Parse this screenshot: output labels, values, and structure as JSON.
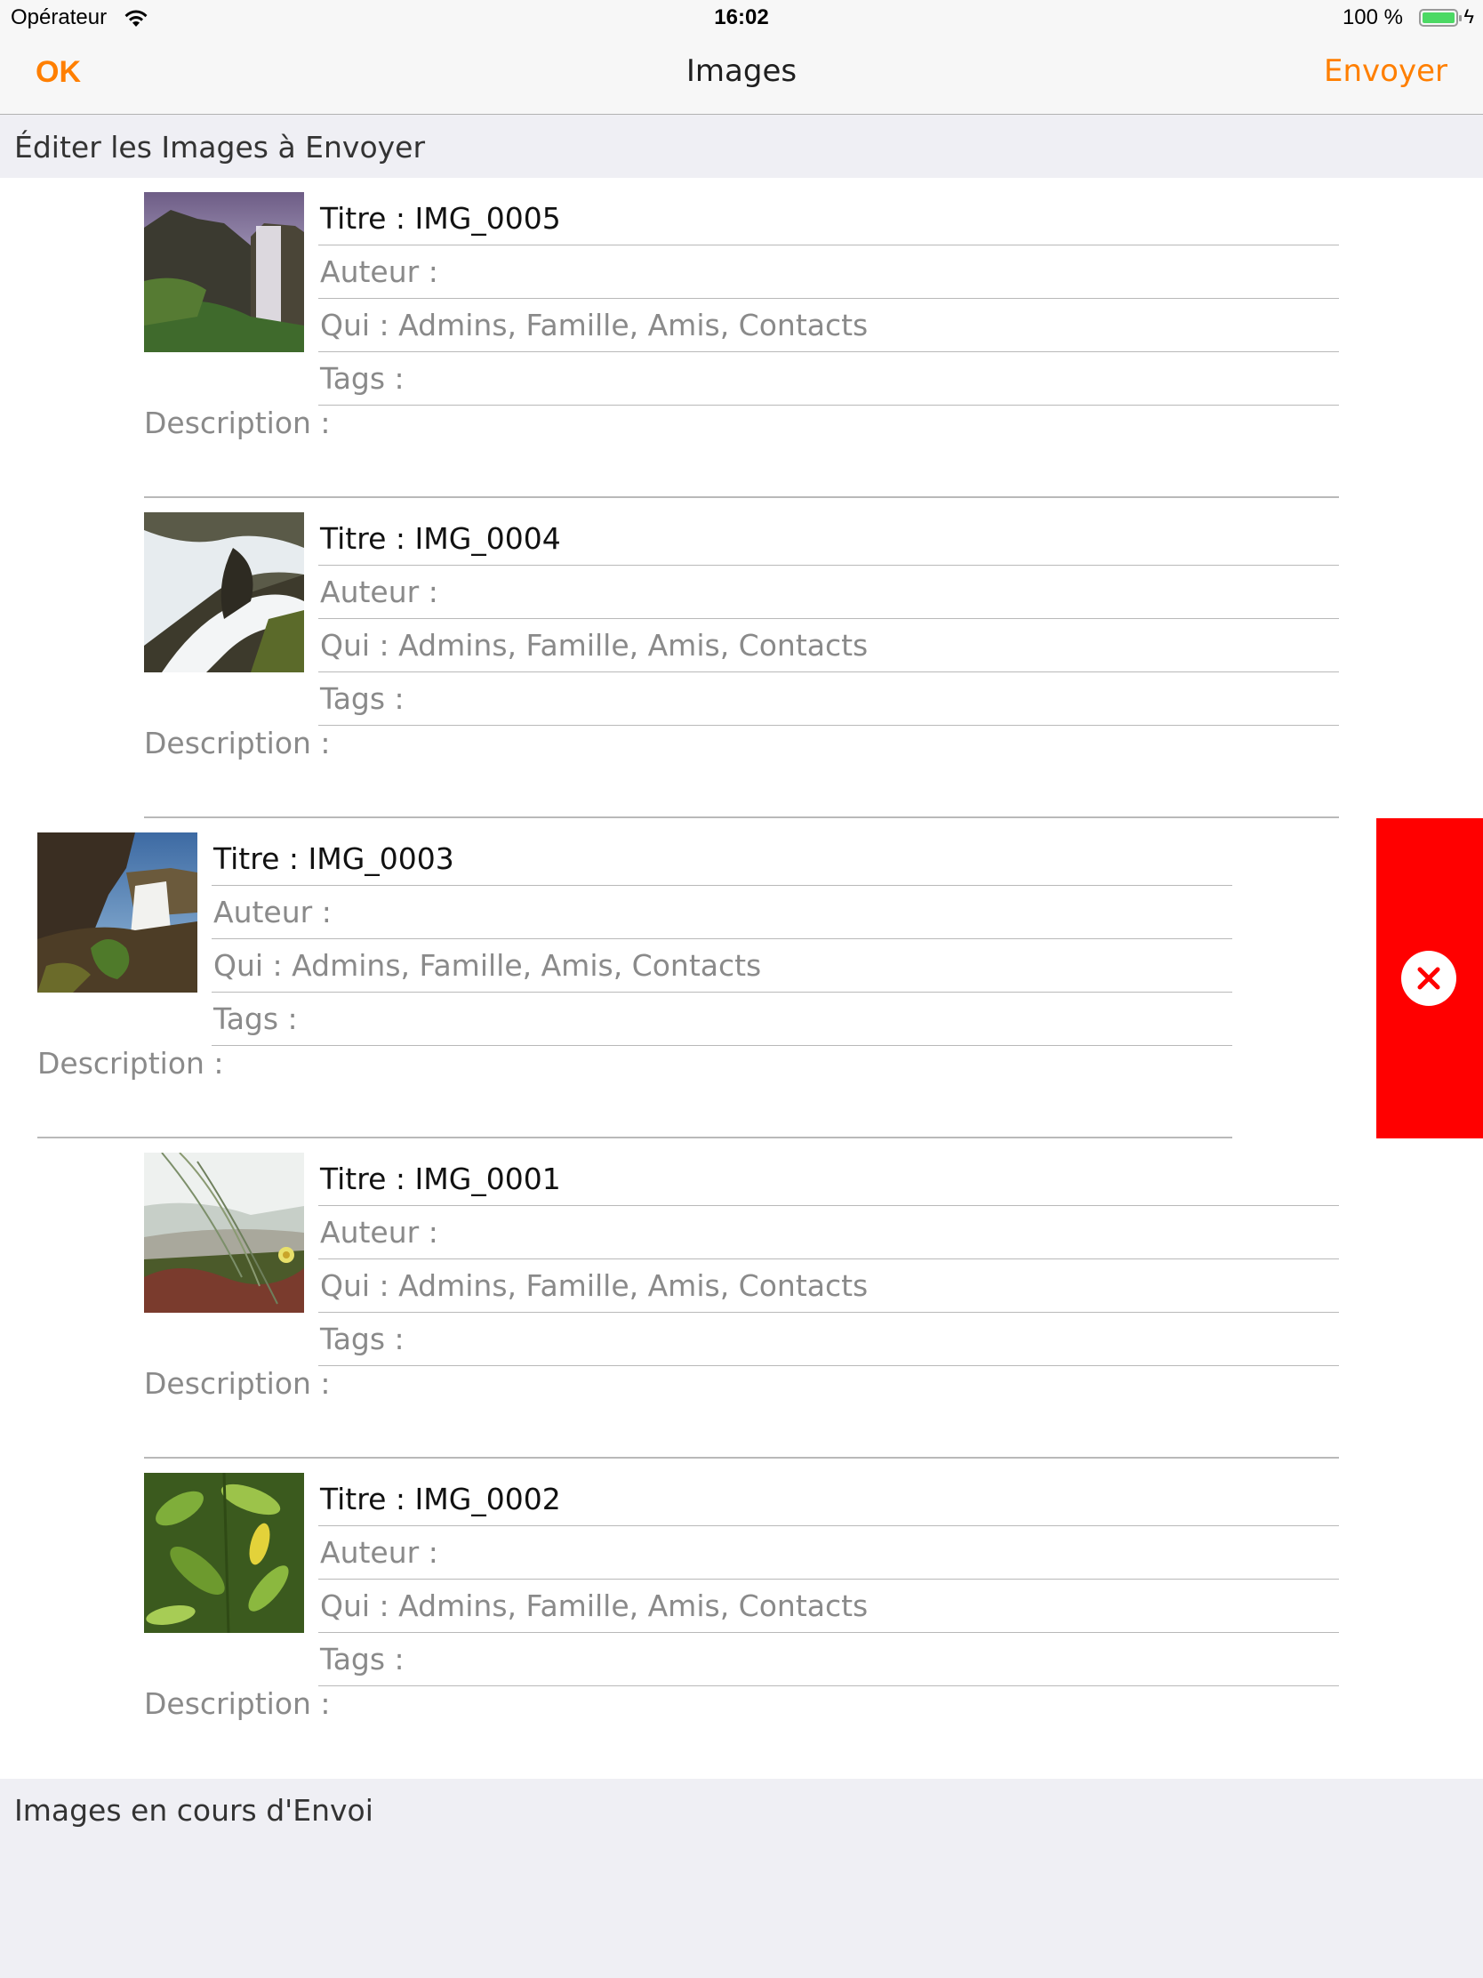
{
  "status_bar": {
    "carrier": "Opérateur",
    "time": "16:02",
    "battery_text": "100 %",
    "wifi_icon": "wifi-icon",
    "battery_icon": "battery-icon",
    "charging_icon": "bolt-icon"
  },
  "nav": {
    "left_button": "OK",
    "title": "Images",
    "right_button": "Envoyer",
    "accent_color": "#ff7f00"
  },
  "sections": {
    "edit_header": "Éditer les Images à Envoyer",
    "uploading_header": "Images en cours d'Envoi"
  },
  "images": [
    {
      "title": "Titre : IMG_0005",
      "author": "Auteur :",
      "who": "Qui : Admins, Famille, Amis, Contacts",
      "tags": "Tags :",
      "description": "Description :",
      "thumbnail": "waterfall-cliff-thumbnail"
    },
    {
      "title": "Titre : IMG_0004",
      "author": "Auteur :",
      "who": "Qui : Admins, Famille, Amis, Contacts",
      "tags": "Tags :",
      "description": "Description :",
      "thumbnail": "cascade-rocks-thumbnail"
    },
    {
      "title": "Titre : IMG_0003",
      "author": "Auteur :",
      "who": "Qui : Admins, Famille, Amis, Contacts",
      "tags": "Tags :",
      "description": "Description :",
      "thumbnail": "waterfall-cave-thumbnail",
      "swiped": true
    },
    {
      "title": "Titre : IMG_0001",
      "author": "Auteur :",
      "who": "Qui : Admins, Famille, Amis, Contacts",
      "tags": "Tags :",
      "description": "Description :",
      "thumbnail": "grass-beach-thumbnail"
    },
    {
      "title": "Titre : IMG_0002",
      "author": "Auteur :",
      "who": "Qui : Admins, Famille, Amis, Contacts",
      "tags": "Tags :",
      "description": "Description :",
      "thumbnail": "green-leaves-thumbnail"
    }
  ],
  "delete_action": {
    "icon": "delete-x-icon",
    "color": "#ff0000"
  }
}
